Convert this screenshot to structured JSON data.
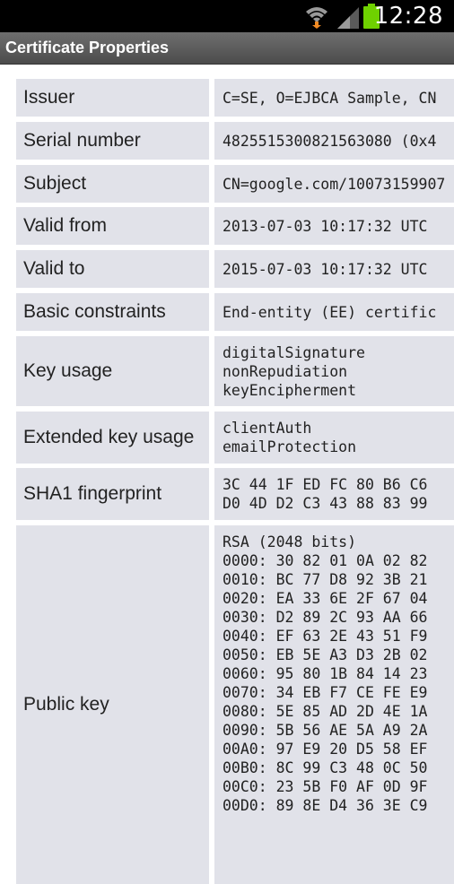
{
  "status": {
    "time": "12:28"
  },
  "header": {
    "title": "Certificate Properties"
  },
  "rows": [
    {
      "label": "Issuer",
      "lines": [
        "C=SE, O=EJBCA Sample, CN"
      ]
    },
    {
      "label": "Serial number",
      "lines": [
        "4825515300821563080 (0x4"
      ]
    },
    {
      "label": "Subject",
      "lines": [
        "CN=google.com/10073159907"
      ]
    },
    {
      "label": "Valid from",
      "lines": [
        "2013-07-03 10:17:32 UTC"
      ]
    },
    {
      "label": "Valid to",
      "lines": [
        "2015-07-03 10:17:32 UTC"
      ]
    },
    {
      "label": "Basic constraints",
      "lines": [
        "End-entity (EE) certific"
      ]
    },
    {
      "label": "Key usage",
      "lines": [
        "digitalSignature",
        "nonRepudiation",
        "keyEncipherment"
      ]
    },
    {
      "label": "Extended key usage",
      "lines": [
        "clientAuth",
        "emailProtection"
      ]
    },
    {
      "label": "SHA1 fingerprint",
      "lines": [
        "3C 44 1F ED FC 80 B6 C6",
        "D0 4D D2 C3 43 88 83 99"
      ]
    },
    {
      "label": "Public key",
      "lines": [
        "RSA (2048 bits)",
        "0000: 30 82 01 0A 02 82",
        "0010: BC 77 D8 92 3B 21",
        "0020: EA 33 6E 2F 67 04",
        "0030: D2 89 2C 93 AA 66",
        "0040: EF 63 2E 43 51 F9",
        "0050: EB 5E A3 D3 2B 02",
        "0060: 95 80 1B 84 14 23",
        "0070: 34 EB F7 CE FE E9",
        "0080: 5E 85 AD 2D 4E 1A",
        "0090: 5B 56 AE 5A A9 2A",
        "00A0: 97 E9 20 D5 58 EF",
        "00B0: 8C 99 C3 48 0C 50",
        "00C0: 23 5B F0 AF 0D 9F",
        "00D0: 89 8E D4 36 3E C9"
      ]
    }
  ]
}
